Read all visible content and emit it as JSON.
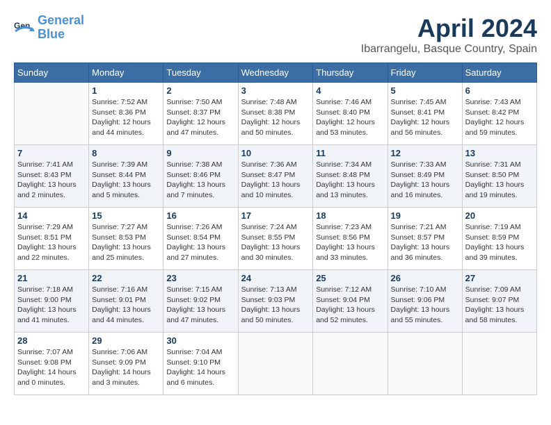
{
  "header": {
    "logo_line1": "General",
    "logo_line2": "Blue",
    "month": "April 2024",
    "location": "Ibarrangelu, Basque Country, Spain"
  },
  "days_of_week": [
    "Sunday",
    "Monday",
    "Tuesday",
    "Wednesday",
    "Thursday",
    "Friday",
    "Saturday"
  ],
  "weeks": [
    [
      {
        "day": "",
        "sunrise": "",
        "sunset": "",
        "daylight": ""
      },
      {
        "day": "1",
        "sunrise": "Sunrise: 7:52 AM",
        "sunset": "Sunset: 8:36 PM",
        "daylight": "Daylight: 12 hours and 44 minutes."
      },
      {
        "day": "2",
        "sunrise": "Sunrise: 7:50 AM",
        "sunset": "Sunset: 8:37 PM",
        "daylight": "Daylight: 12 hours and 47 minutes."
      },
      {
        "day": "3",
        "sunrise": "Sunrise: 7:48 AM",
        "sunset": "Sunset: 8:38 PM",
        "daylight": "Daylight: 12 hours and 50 minutes."
      },
      {
        "day": "4",
        "sunrise": "Sunrise: 7:46 AM",
        "sunset": "Sunset: 8:40 PM",
        "daylight": "Daylight: 12 hours and 53 minutes."
      },
      {
        "day": "5",
        "sunrise": "Sunrise: 7:45 AM",
        "sunset": "Sunset: 8:41 PM",
        "daylight": "Daylight: 12 hours and 56 minutes."
      },
      {
        "day": "6",
        "sunrise": "Sunrise: 7:43 AM",
        "sunset": "Sunset: 8:42 PM",
        "daylight": "Daylight: 12 hours and 59 minutes."
      }
    ],
    [
      {
        "day": "7",
        "sunrise": "Sunrise: 7:41 AM",
        "sunset": "Sunset: 8:43 PM",
        "daylight": "Daylight: 13 hours and 2 minutes."
      },
      {
        "day": "8",
        "sunrise": "Sunrise: 7:39 AM",
        "sunset": "Sunset: 8:44 PM",
        "daylight": "Daylight: 13 hours and 5 minutes."
      },
      {
        "day": "9",
        "sunrise": "Sunrise: 7:38 AM",
        "sunset": "Sunset: 8:46 PM",
        "daylight": "Daylight: 13 hours and 7 minutes."
      },
      {
        "day": "10",
        "sunrise": "Sunrise: 7:36 AM",
        "sunset": "Sunset: 8:47 PM",
        "daylight": "Daylight: 13 hours and 10 minutes."
      },
      {
        "day": "11",
        "sunrise": "Sunrise: 7:34 AM",
        "sunset": "Sunset: 8:48 PM",
        "daylight": "Daylight: 13 hours and 13 minutes."
      },
      {
        "day": "12",
        "sunrise": "Sunrise: 7:33 AM",
        "sunset": "Sunset: 8:49 PM",
        "daylight": "Daylight: 13 hours and 16 minutes."
      },
      {
        "day": "13",
        "sunrise": "Sunrise: 7:31 AM",
        "sunset": "Sunset: 8:50 PM",
        "daylight": "Daylight: 13 hours and 19 minutes."
      }
    ],
    [
      {
        "day": "14",
        "sunrise": "Sunrise: 7:29 AM",
        "sunset": "Sunset: 8:51 PM",
        "daylight": "Daylight: 13 hours and 22 minutes."
      },
      {
        "day": "15",
        "sunrise": "Sunrise: 7:27 AM",
        "sunset": "Sunset: 8:53 PM",
        "daylight": "Daylight: 13 hours and 25 minutes."
      },
      {
        "day": "16",
        "sunrise": "Sunrise: 7:26 AM",
        "sunset": "Sunset: 8:54 PM",
        "daylight": "Daylight: 13 hours and 27 minutes."
      },
      {
        "day": "17",
        "sunrise": "Sunrise: 7:24 AM",
        "sunset": "Sunset: 8:55 PM",
        "daylight": "Daylight: 13 hours and 30 minutes."
      },
      {
        "day": "18",
        "sunrise": "Sunrise: 7:23 AM",
        "sunset": "Sunset: 8:56 PM",
        "daylight": "Daylight: 13 hours and 33 minutes."
      },
      {
        "day": "19",
        "sunrise": "Sunrise: 7:21 AM",
        "sunset": "Sunset: 8:57 PM",
        "daylight": "Daylight: 13 hours and 36 minutes."
      },
      {
        "day": "20",
        "sunrise": "Sunrise: 7:19 AM",
        "sunset": "Sunset: 8:59 PM",
        "daylight": "Daylight: 13 hours and 39 minutes."
      }
    ],
    [
      {
        "day": "21",
        "sunrise": "Sunrise: 7:18 AM",
        "sunset": "Sunset: 9:00 PM",
        "daylight": "Daylight: 13 hours and 41 minutes."
      },
      {
        "day": "22",
        "sunrise": "Sunrise: 7:16 AM",
        "sunset": "Sunset: 9:01 PM",
        "daylight": "Daylight: 13 hours and 44 minutes."
      },
      {
        "day": "23",
        "sunrise": "Sunrise: 7:15 AM",
        "sunset": "Sunset: 9:02 PM",
        "daylight": "Daylight: 13 hours and 47 minutes."
      },
      {
        "day": "24",
        "sunrise": "Sunrise: 7:13 AM",
        "sunset": "Sunset: 9:03 PM",
        "daylight": "Daylight: 13 hours and 50 minutes."
      },
      {
        "day": "25",
        "sunrise": "Sunrise: 7:12 AM",
        "sunset": "Sunset: 9:04 PM",
        "daylight": "Daylight: 13 hours and 52 minutes."
      },
      {
        "day": "26",
        "sunrise": "Sunrise: 7:10 AM",
        "sunset": "Sunset: 9:06 PM",
        "daylight": "Daylight: 13 hours and 55 minutes."
      },
      {
        "day": "27",
        "sunrise": "Sunrise: 7:09 AM",
        "sunset": "Sunset: 9:07 PM",
        "daylight": "Daylight: 13 hours and 58 minutes."
      }
    ],
    [
      {
        "day": "28",
        "sunrise": "Sunrise: 7:07 AM",
        "sunset": "Sunset: 9:08 PM",
        "daylight": "Daylight: 14 hours and 0 minutes."
      },
      {
        "day": "29",
        "sunrise": "Sunrise: 7:06 AM",
        "sunset": "Sunset: 9:09 PM",
        "daylight": "Daylight: 14 hours and 3 minutes."
      },
      {
        "day": "30",
        "sunrise": "Sunrise: 7:04 AM",
        "sunset": "Sunset: 9:10 PM",
        "daylight": "Daylight: 14 hours and 6 minutes."
      },
      {
        "day": "",
        "sunrise": "",
        "sunset": "",
        "daylight": ""
      },
      {
        "day": "",
        "sunrise": "",
        "sunset": "",
        "daylight": ""
      },
      {
        "day": "",
        "sunrise": "",
        "sunset": "",
        "daylight": ""
      },
      {
        "day": "",
        "sunrise": "",
        "sunset": "",
        "daylight": ""
      }
    ]
  ]
}
